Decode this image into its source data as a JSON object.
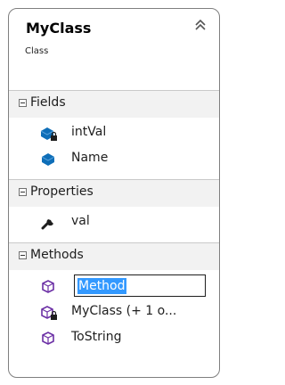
{
  "class": {
    "name": "MyClass",
    "kind": "Class"
  },
  "sections": {
    "fields": "Fields",
    "properties": "Properties",
    "methods": "Methods"
  },
  "fields": [
    {
      "label": "intVal",
      "icon": "private-field-icon"
    },
    {
      "label": "Name",
      "icon": "field-icon"
    }
  ],
  "properties": [
    {
      "label": "val",
      "icon": "wrench-property-icon"
    }
  ],
  "methods": [
    {
      "label": "Method",
      "icon": "method-icon",
      "editing": true
    },
    {
      "label": "MyClass (+ 1 o...",
      "icon": "private-method-icon"
    },
    {
      "label": "ToString",
      "icon": "method-icon"
    }
  ],
  "colors": {
    "accent": "#0e6eb8",
    "method": "#6b2fa5",
    "selection": "#3399ff",
    "lock": "#c9a227"
  }
}
